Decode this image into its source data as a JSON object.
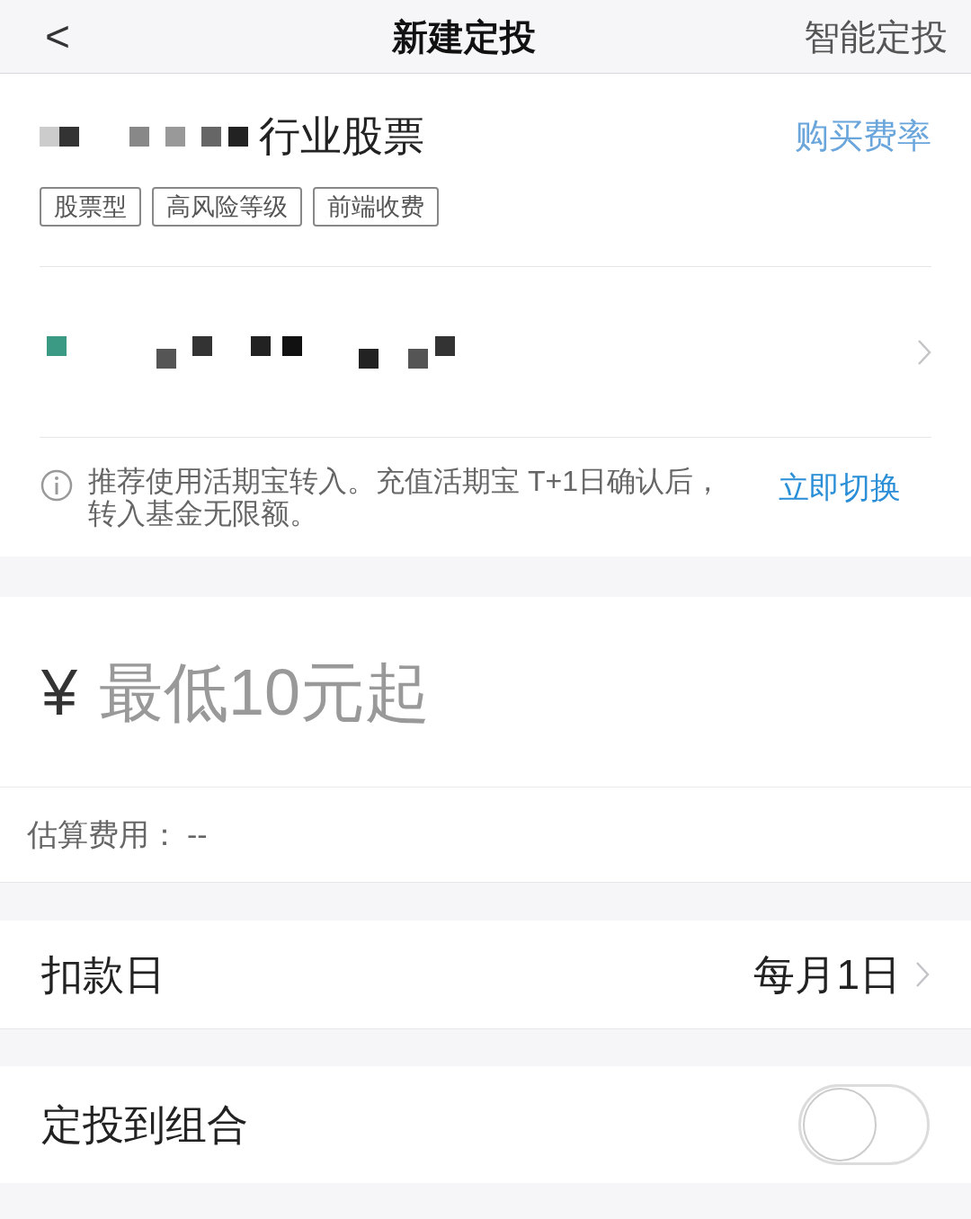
{
  "nav": {
    "back": "<",
    "title": "新建定投",
    "action": "智能定投"
  },
  "fund": {
    "name": "行业股票",
    "fee_link": "购买费率",
    "tags": [
      "股票型",
      "高风险等级",
      "前端收费"
    ]
  },
  "notice": {
    "text": "推荐使用活期宝转入。充值活期宝 T+1日确认后，转入基金无限额。",
    "action": "立即切换"
  },
  "amount": {
    "currency": "¥",
    "placeholder": "最低10元起"
  },
  "fee": {
    "label": "估算费用：",
    "value": "--"
  },
  "deduction": {
    "label": "扣款日",
    "value": "每月1日"
  },
  "combo": {
    "label": "定投到组合",
    "on": false
  }
}
